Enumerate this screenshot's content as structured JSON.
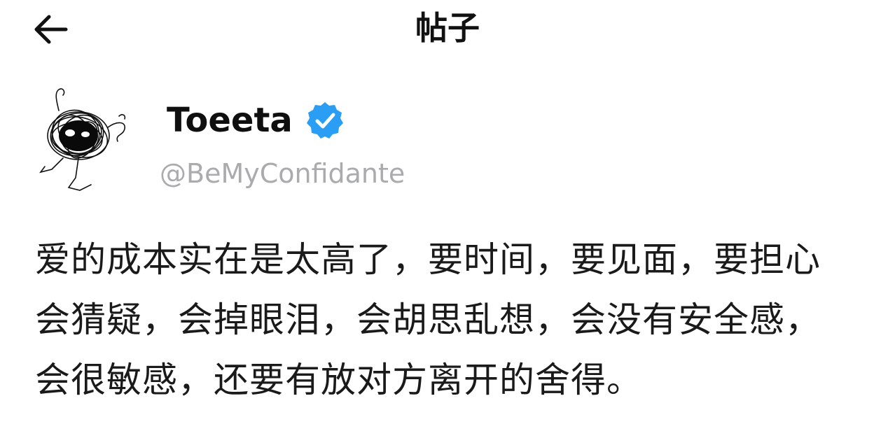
{
  "header": {
    "title": "帖子",
    "back_icon": "arrow-left-icon"
  },
  "author": {
    "display_name": "Toeeta",
    "handle": "@BeMyConfidante",
    "verified_icon": "verified-badge-icon",
    "verified_color": "#2a9df4"
  },
  "post": {
    "lines": [
      "爱的成本实在是太高了，要时间，要见面，要担心",
      "会猜疑，会掉眼泪，会胡思乱想，会没有安全感，",
      "会很敏感，还要有放对方离开的舍得。"
    ]
  }
}
